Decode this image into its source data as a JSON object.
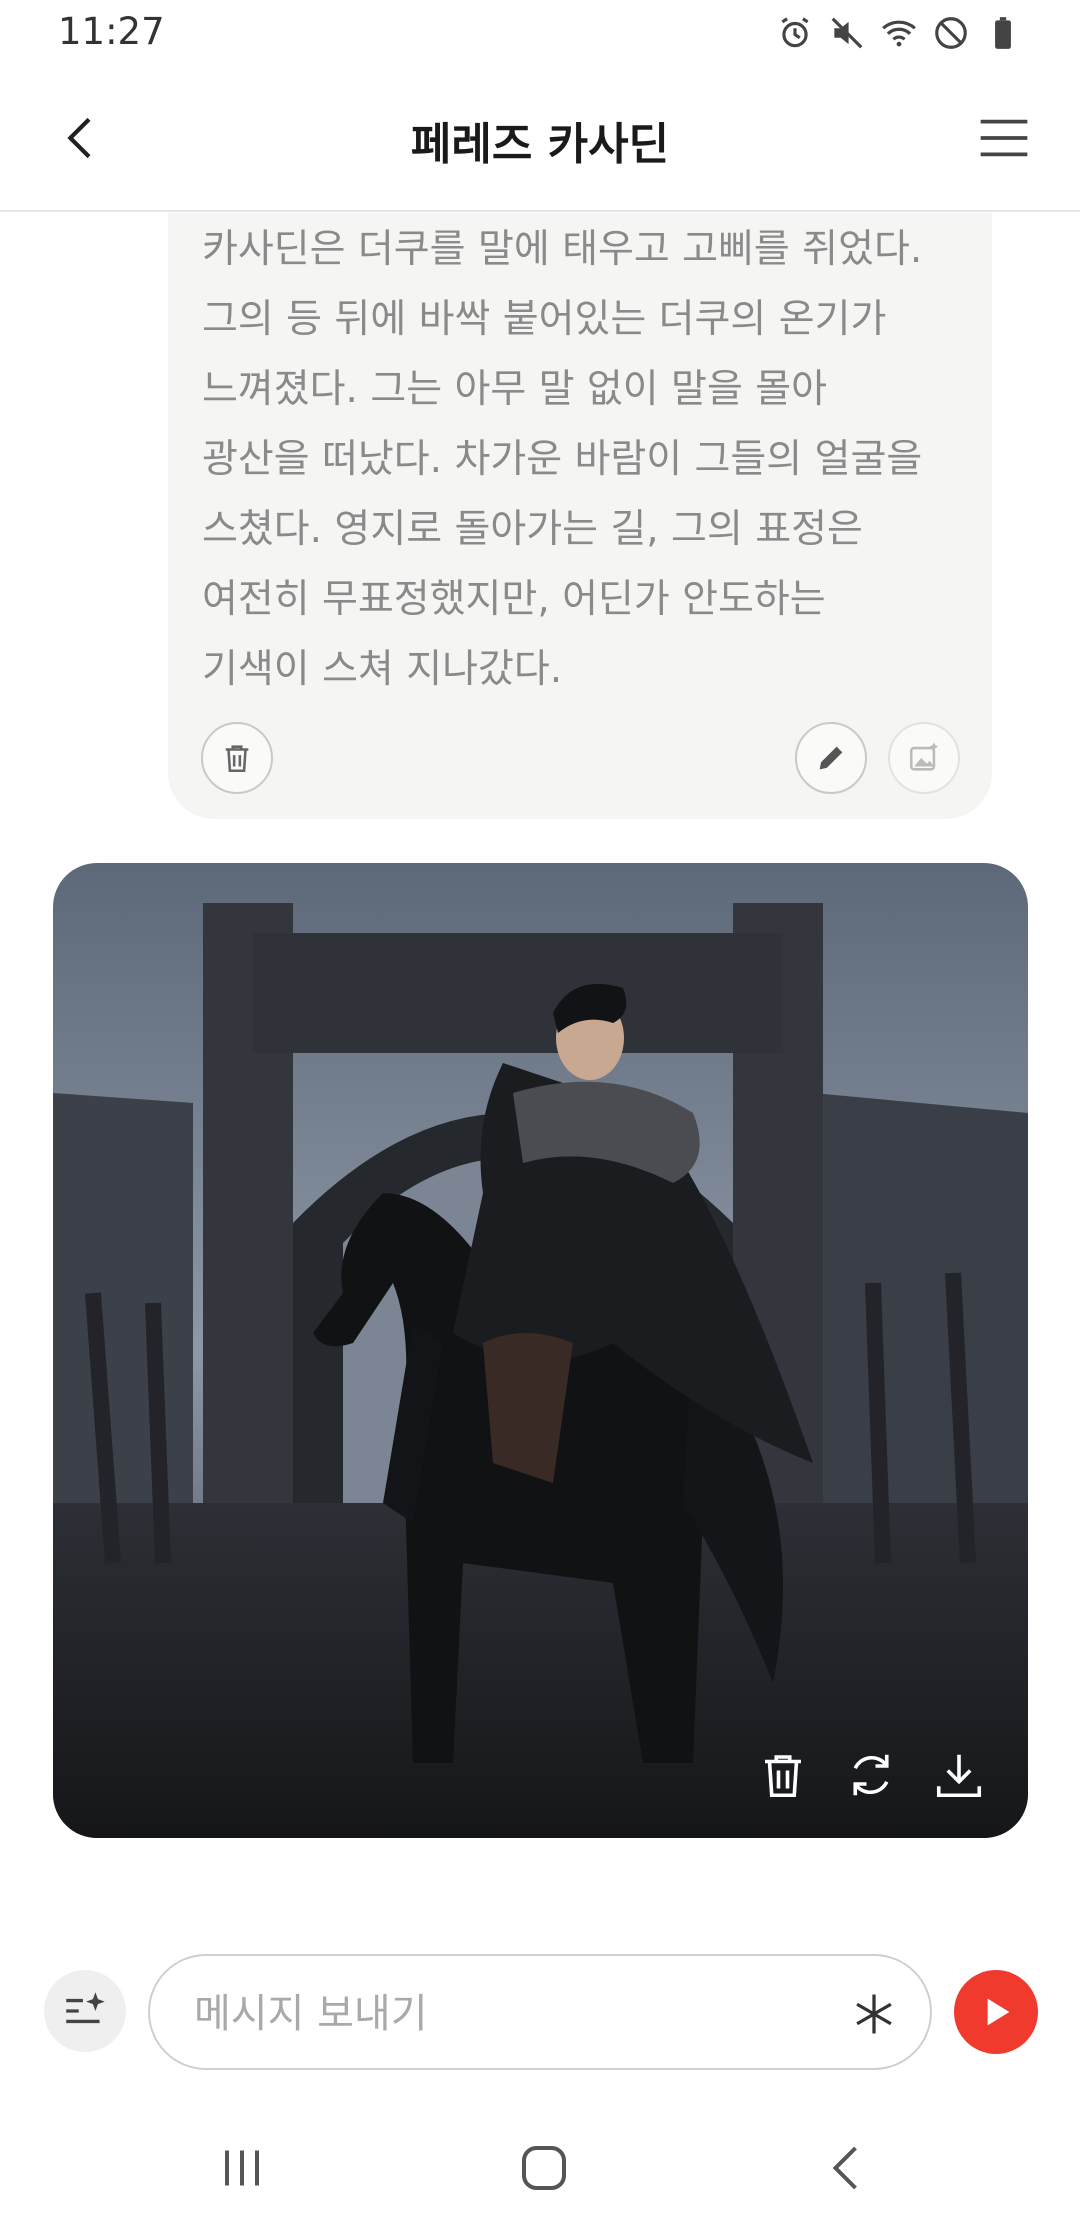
{
  "status_bar": {
    "time": "11:27",
    "icons": [
      "alarm-icon",
      "mute-icon",
      "wifi-icon",
      "do-not-disturb-icon",
      "battery-icon"
    ]
  },
  "header": {
    "title": "페레즈 카사딘",
    "back_icon": "chevron-left-icon",
    "menu_icon": "hamburger-menu-icon"
  },
  "narration": {
    "lines": [
      "카사딘은 더쿠를 말에 태우고 고삐를 쥐었다.",
      "그의 등 뒤에 바싹 붙어있는 더쿠의 온기가",
      "느껴졌다. 그는 아무 말 없이 말을 몰아",
      "광산을 떠났다. 차가운 바람이 그들의 얼굴을",
      "스쳤다. 영지로 돌아가는 길, 그의 표정은",
      "여전히 무표정했지만, 어딘가 안도하는",
      "기색이 스쳐 지나갔다."
    ],
    "actions": [
      "trash-icon",
      "pencil-icon",
      "image-sparkle-icon"
    ]
  },
  "scene_image": {
    "actions": [
      "trash-icon",
      "refresh-icon",
      "download-icon"
    ]
  },
  "composer": {
    "placeholder": "메시지 보내기",
    "assist_icon": "sparkle-list-icon",
    "asterisk_icon": "asterisk-icon",
    "send_icon": "play-icon",
    "send_color": "#f03a2e"
  },
  "nav_bar": {
    "items": [
      "recents-icon",
      "home-icon",
      "back-icon"
    ]
  }
}
